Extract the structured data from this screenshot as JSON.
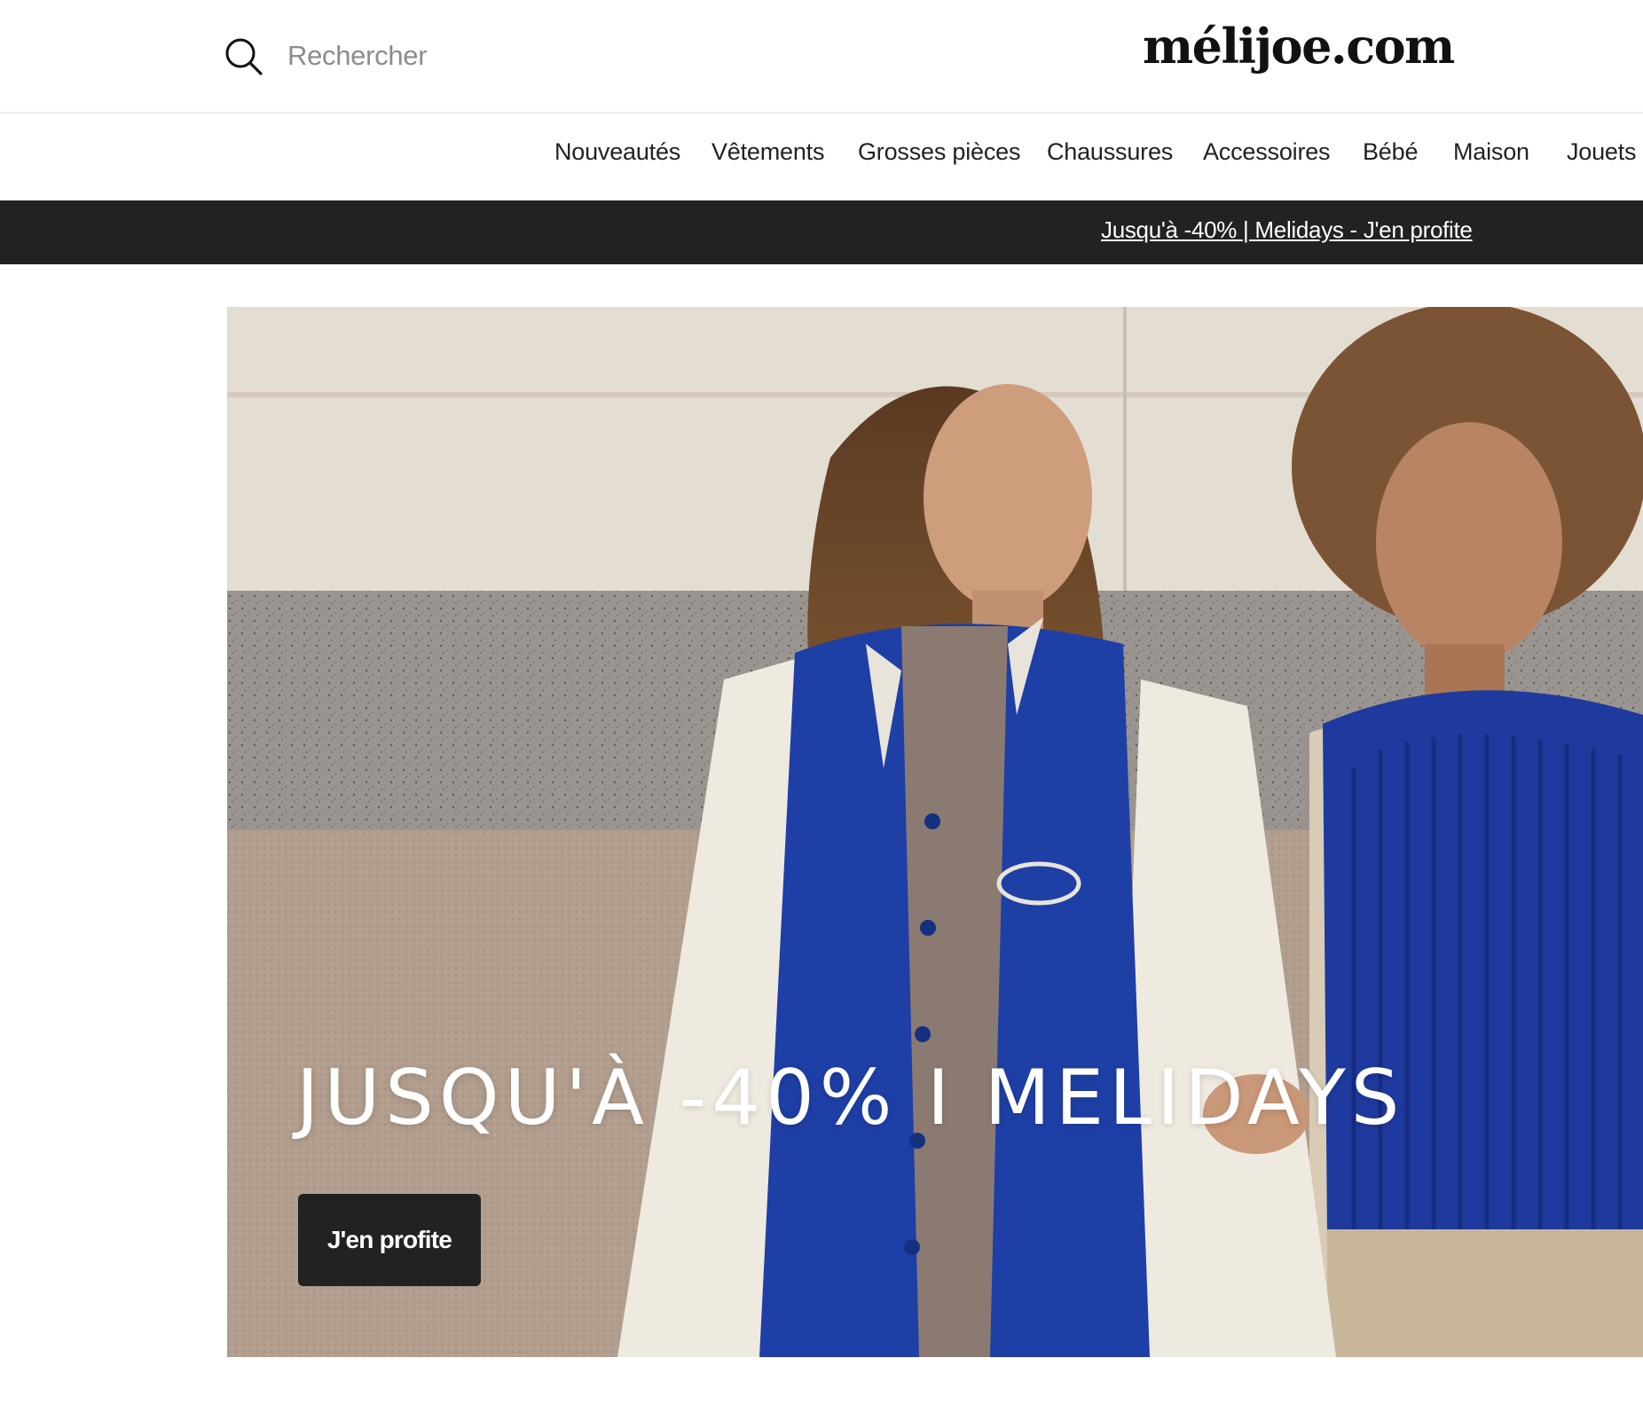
{
  "header": {
    "search": {
      "placeholder": "Rechercher"
    },
    "logo": "mélijoe.com"
  },
  "nav": {
    "items": [
      {
        "label": "Nouveautés"
      },
      {
        "label": "Vêtements"
      },
      {
        "label": "Grosses pièces"
      },
      {
        "label": "Chaussures"
      },
      {
        "label": "Accessoires"
      },
      {
        "label": "Bébé"
      },
      {
        "label": "Maison"
      },
      {
        "label": "Jouets"
      }
    ]
  },
  "promo": {
    "link": "Jusqu'à -40% | Melidays - J'en profite"
  },
  "hero": {
    "title": "JUSQU'À -40% I MELIDAYS",
    "cta": "J'en profite",
    "image": "two-children-varsity-jacket-knit-vest-photo"
  },
  "colors": {
    "dark": "#222222",
    "jacket_blue": "#1e3fa6",
    "sleeve_cream": "#efeadf",
    "wall_stone": "#e4ddd1"
  }
}
